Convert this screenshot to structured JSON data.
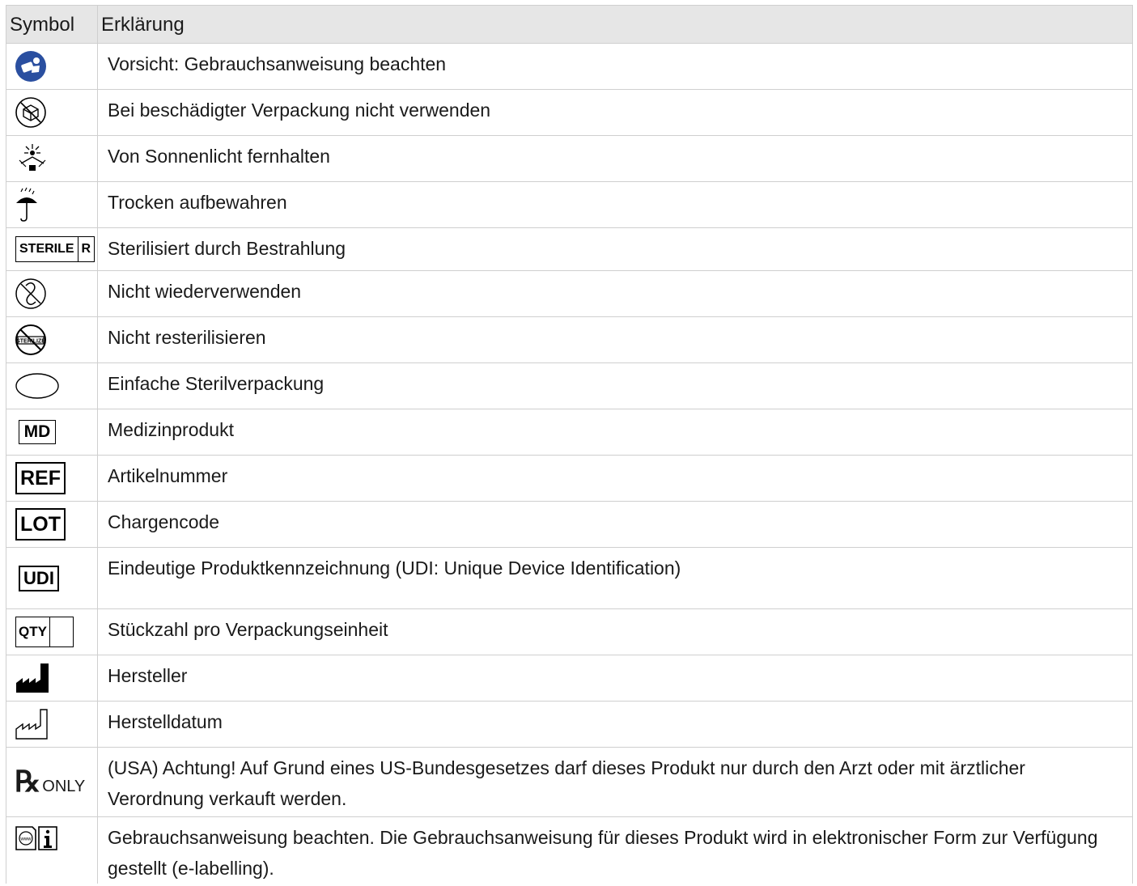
{
  "header": {
    "symbol": "Symbol",
    "explanation": "Erklärung"
  },
  "rows": [
    {
      "icon": "consult-instructions-blue-icon",
      "text": "Vorsicht: Gebrauchsanweisung beachten"
    },
    {
      "icon": "damaged-package-icon",
      "text": "Bei beschädigter Verpackung nicht verwenden"
    },
    {
      "icon": "keep-away-sunlight-icon",
      "text": "Von Sonnenlicht fernhalten"
    },
    {
      "icon": "keep-dry-umbrella-icon",
      "text": "Trocken aufbewahren"
    },
    {
      "icon": "sterile-r-icon",
      "text": "Sterilisiert durch Bestrahlung",
      "label": "STERILE",
      "label2": "R"
    },
    {
      "icon": "do-not-reuse-icon",
      "text": "Nicht wiederverwenden"
    },
    {
      "icon": "do-not-resterilize-icon",
      "text": "Nicht resterilisieren"
    },
    {
      "icon": "single-sterile-barrier-icon",
      "text": "Einfache Sterilverpackung"
    },
    {
      "icon": "medical-device-icon",
      "text": "Medizinprodukt",
      "label": "MD"
    },
    {
      "icon": "catalogue-number-icon",
      "text": "Artikelnummer",
      "label": "REF"
    },
    {
      "icon": "batch-code-icon",
      "text": "Chargencode",
      "label": "LOT"
    },
    {
      "icon": "udi-icon",
      "text": "Eindeutige Produktkennzeichnung (UDI: Unique Device Identification)",
      "label": "UDI"
    },
    {
      "icon": "quantity-icon",
      "text": "Stückzahl pro Verpackungseinheit",
      "label": "QTY"
    },
    {
      "icon": "manufacturer-icon",
      "text": "Hersteller"
    },
    {
      "icon": "date-of-manufacture-icon",
      "text": "Herstelldatum"
    },
    {
      "icon": "rx-only-icon",
      "text": "(USA) Achtung! Auf Grund eines US-Bundesgesetzes darf dieses Produkt nur durch den Arzt oder mit ärztlicher Verordnung verkauft werden.",
      "label": "ONLY"
    },
    {
      "icon": "e-labelling-icon",
      "text": "Gebrauchsanweisung beachten. Die Gebrauchsanweisung für dieses Produkt wird in elektronischer Form zur Verfügung gestellt (e-labelling)."
    }
  ]
}
